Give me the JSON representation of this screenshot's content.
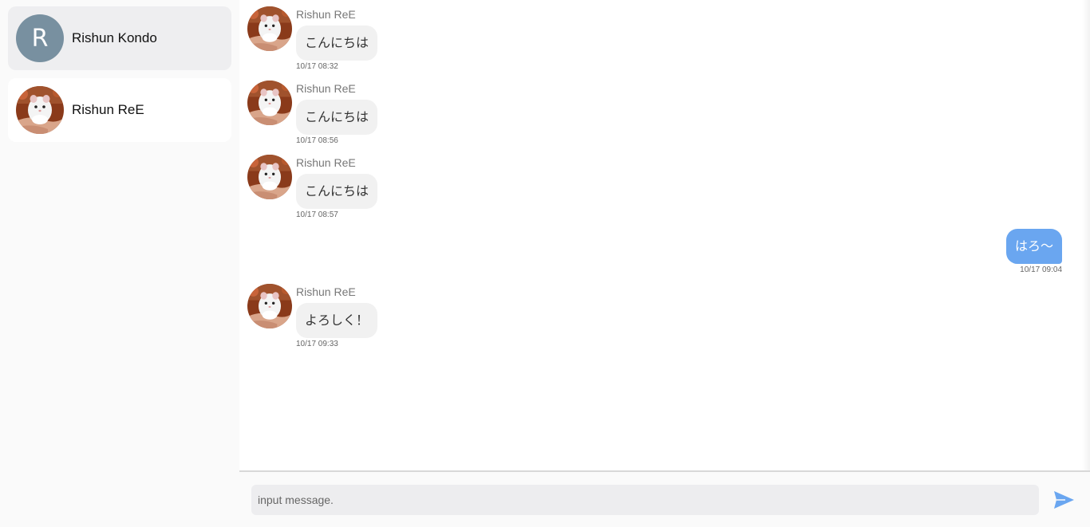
{
  "colors": {
    "sidebar_bg": "#fafafa",
    "active_contact_bg": "#eeeef0",
    "letter_avatar_bg": "#7890a0",
    "incoming_bubble": "#f1f1f1",
    "outgoing_bubble": "#6aa6f0",
    "send_icon": "#6aa6f0"
  },
  "sidebar": {
    "contacts": [
      {
        "name": "Rishun Kondo",
        "avatar_letter": "R",
        "avatar_type": "letter",
        "active": true
      },
      {
        "name": "Rishun ReE",
        "avatar_type": "photo-hamster",
        "active": false
      }
    ]
  },
  "chat": {
    "messages": [
      {
        "direction": "incoming",
        "sender": "Rishun ReE",
        "text": "こんにちは",
        "time": "10/17 08:32"
      },
      {
        "direction": "incoming",
        "sender": "Rishun ReE",
        "text": "こんにちは",
        "time": "10/17 08:56"
      },
      {
        "direction": "incoming",
        "sender": "Rishun ReE",
        "text": "こんにちは",
        "time": "10/17 08:57"
      },
      {
        "direction": "outgoing",
        "text": "はろ〜",
        "time": "10/17 09:04"
      },
      {
        "direction": "incoming",
        "sender": "Rishun ReE",
        "text": "よろしく！",
        "time": "10/17 09:33"
      }
    ]
  },
  "composer": {
    "placeholder": "input message.",
    "value": "",
    "send_icon": "send-icon"
  }
}
